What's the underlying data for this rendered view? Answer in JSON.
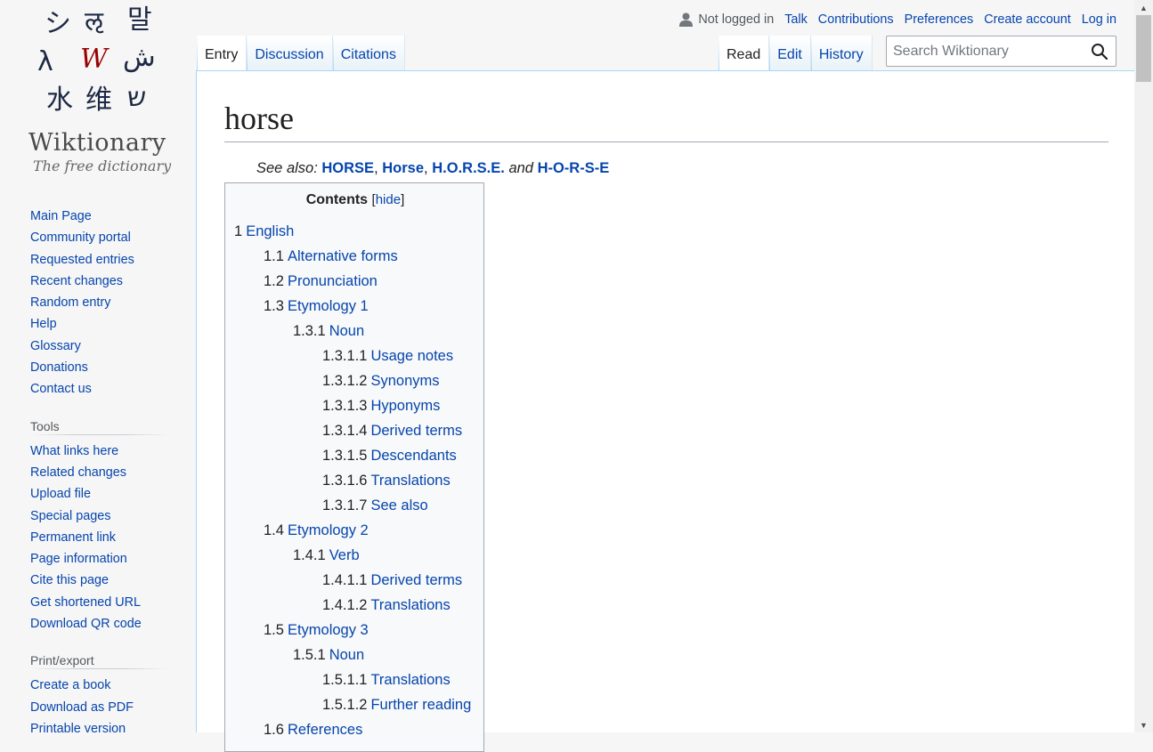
{
  "logo": {
    "glyphs": [
      "シ",
      "ऌ",
      "말",
      "λ",
      "W",
      "ش",
      "水",
      "维",
      "ש"
    ],
    "wordmark": "Wiktionary",
    "tagline": "The free dictionary"
  },
  "personal": {
    "status": "Not logged in",
    "links": [
      "Talk",
      "Contributions",
      "Preferences",
      "Create account",
      "Log in"
    ]
  },
  "tabs": {
    "left": [
      {
        "label": "Entry",
        "selected": true
      },
      {
        "label": "Discussion",
        "selected": false
      },
      {
        "label": "Citations",
        "selected": false
      }
    ],
    "right": [
      {
        "label": "Read",
        "selected": true
      },
      {
        "label": "Edit",
        "selected": false
      },
      {
        "label": "History",
        "selected": false
      }
    ]
  },
  "search": {
    "placeholder": "Search Wiktionary"
  },
  "sidebar": {
    "navigation": [
      "Main Page",
      "Community portal",
      "Requested entries",
      "Recent changes",
      "Random entry",
      "Help",
      "Glossary",
      "Donations",
      "Contact us"
    ],
    "tools_heading": "Tools",
    "tools": [
      "What links here",
      "Related changes",
      "Upload file",
      "Special pages",
      "Permanent link",
      "Page information",
      "Cite this page",
      "Get shortened URL",
      "Download QR code"
    ],
    "print_heading": "Print/export",
    "print": [
      "Create a book",
      "Download as PDF",
      "Printable version"
    ]
  },
  "page": {
    "title": "horse",
    "see_also_prefix": "See also:",
    "see_also_links": [
      "HORSE",
      "Horse",
      "H.O.R.S.E."
    ],
    "see_also_and": "and",
    "see_also_last": "H-O-R-S-E"
  },
  "toc": {
    "title": "Contents",
    "hide_label": "hide",
    "items": [
      {
        "num": "1",
        "label": "English",
        "level": 1
      },
      {
        "num": "1.1",
        "label": "Alternative forms",
        "level": 2
      },
      {
        "num": "1.2",
        "label": "Pronunciation",
        "level": 2
      },
      {
        "num": "1.3",
        "label": "Etymology 1",
        "level": 2
      },
      {
        "num": "1.3.1",
        "label": "Noun",
        "level": 3
      },
      {
        "num": "1.3.1.1",
        "label": "Usage notes",
        "level": 4
      },
      {
        "num": "1.3.1.2",
        "label": "Synonyms",
        "level": 4
      },
      {
        "num": "1.3.1.3",
        "label": "Hyponyms",
        "level": 4
      },
      {
        "num": "1.3.1.4",
        "label": "Derived terms",
        "level": 4
      },
      {
        "num": "1.3.1.5",
        "label": "Descendants",
        "level": 4
      },
      {
        "num": "1.3.1.6",
        "label": "Translations",
        "level": 4
      },
      {
        "num": "1.3.1.7",
        "label": "See also",
        "level": 4
      },
      {
        "num": "1.4",
        "label": "Etymology 2",
        "level": 2
      },
      {
        "num": "1.4.1",
        "label": "Verb",
        "level": 3
      },
      {
        "num": "1.4.1.1",
        "label": "Derived terms",
        "level": 4
      },
      {
        "num": "1.4.1.2",
        "label": "Translations",
        "level": 4
      },
      {
        "num": "1.5",
        "label": "Etymology 3",
        "level": 2
      },
      {
        "num": "1.5.1",
        "label": "Noun",
        "level": 3
      },
      {
        "num": "1.5.1.1",
        "label": "Translations",
        "level": 4
      },
      {
        "num": "1.5.1.2",
        "label": "Further reading",
        "level": 4
      },
      {
        "num": "1.6",
        "label": "References",
        "level": 2
      }
    ]
  },
  "colors": {
    "link": "#0645ad",
    "text": "#202122",
    "border": "#a7d7f9",
    "background": "#f6f6f6"
  }
}
